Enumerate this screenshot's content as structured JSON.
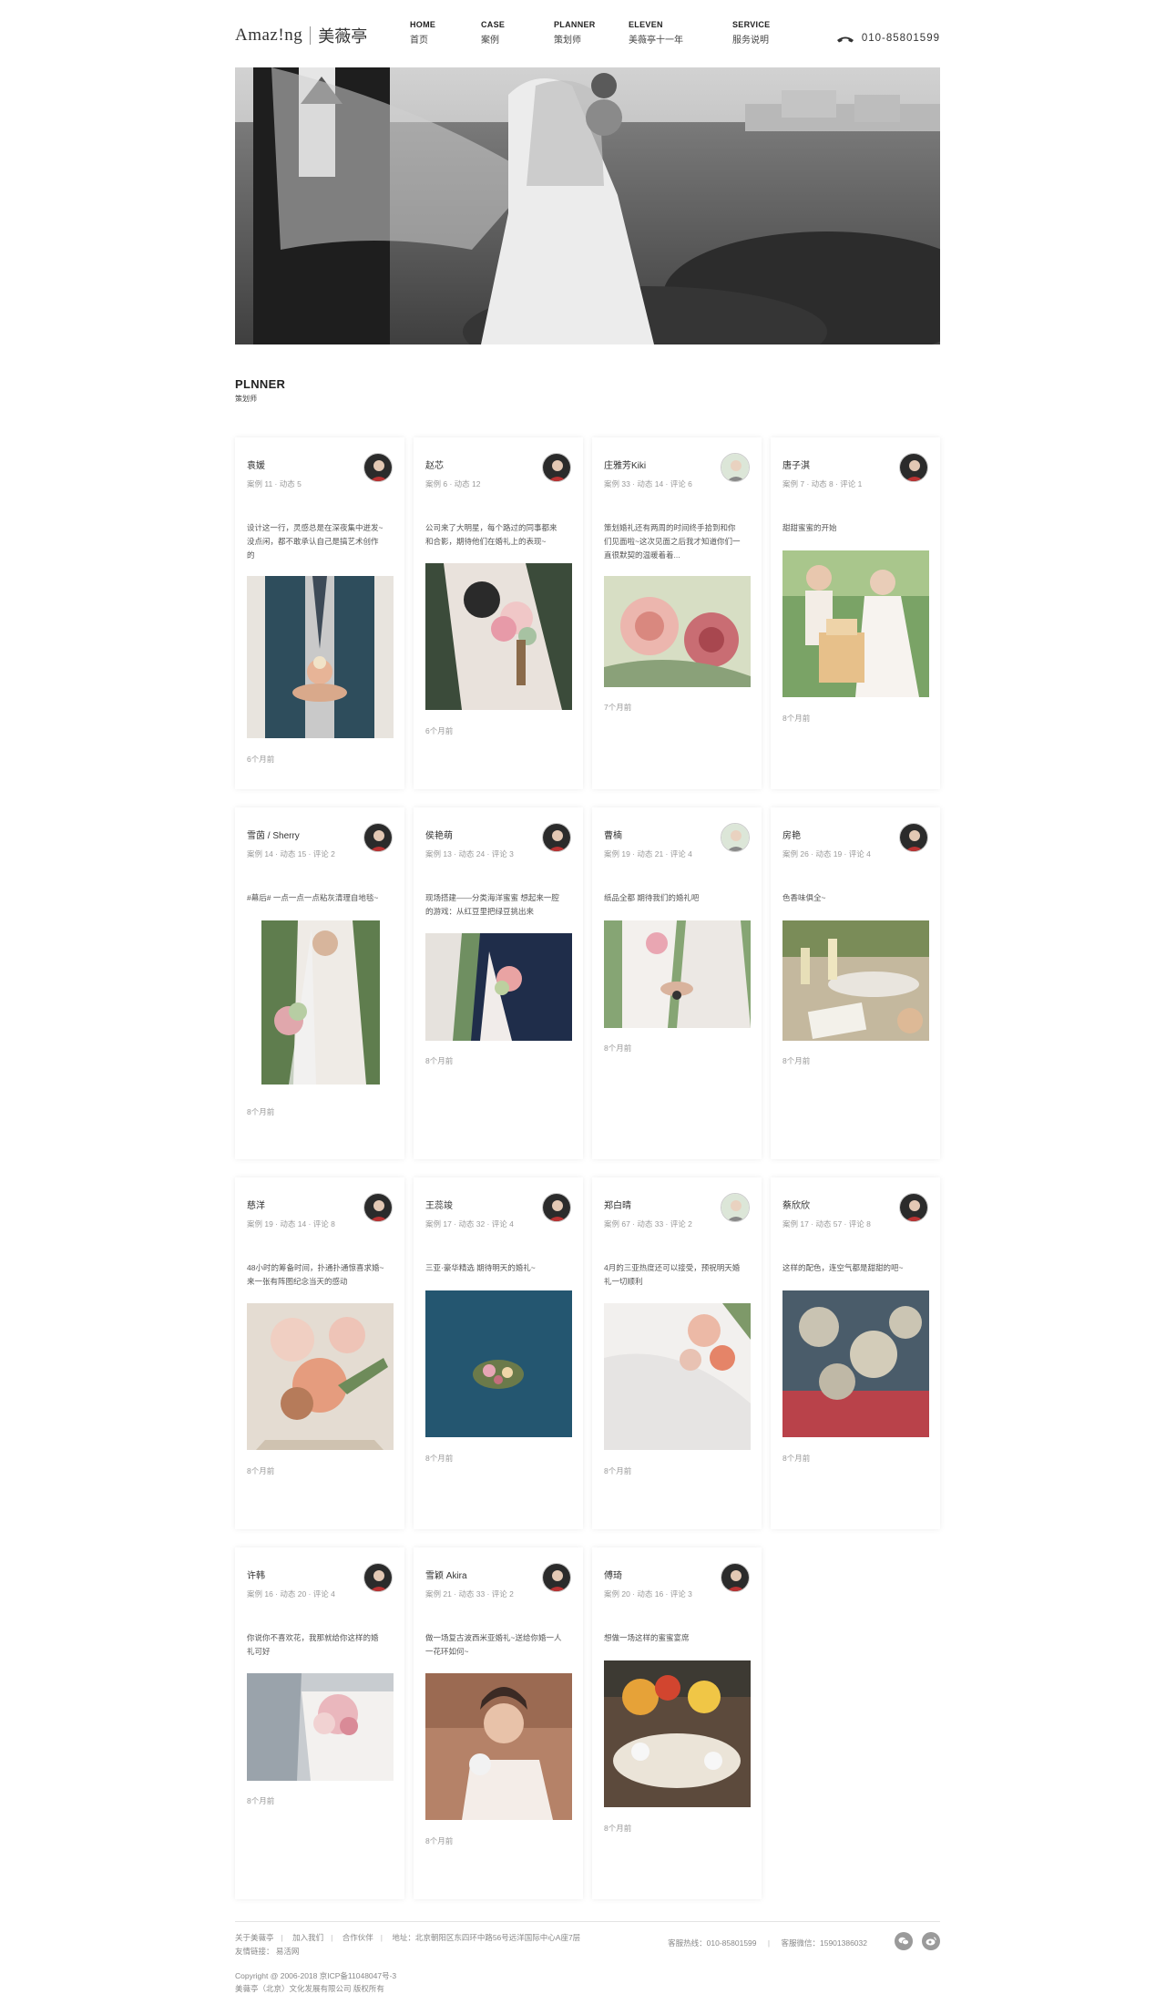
{
  "header": {
    "logo_en": "Amaz!ng",
    "logo_cn": "美薇亭",
    "nav": [
      {
        "en": "HOME",
        "cn": "首页"
      },
      {
        "en": "CASE",
        "cn": "案例"
      },
      {
        "en": "PLANNER",
        "cn": "策划师"
      },
      {
        "en": "ELEVEN",
        "cn": "美薇亭十一年"
      },
      {
        "en": "SERVICE",
        "cn": "服务说明"
      }
    ],
    "phone": "010-85801599"
  },
  "section": {
    "title_en": "PLNNER",
    "title_cn": "策划师"
  },
  "cards": [
    {
      "name": "袁媛",
      "meta": "案例 11 · 动态 5",
      "text": "设计这一行，灵感总是在深夜集中迸发~没点闲，都不敢承认自己是搞艺术创作的",
      "time": "6个月前"
    },
    {
      "name": "赵芯",
      "meta": "案例 6 · 动态 12",
      "text": "公司来了大明星，每个路过的同事都来和合影，期待他们在婚礼上的表现~",
      "time": "6个月前"
    },
    {
      "name": "庄雅芳Kiki",
      "meta": "案例 33 · 动态 14 · 评论 6",
      "text": "策划婚礼还有两周的时间终手拾到和你们见面啦~这次见面之后我才知道你们一直很默契的温暖着着...",
      "time": "7个月前"
    },
    {
      "name": "唐子淇",
      "meta": "案例 7 · 动态 8 · 评论 1",
      "text": "甜甜蜜蜜的开始",
      "time": "8个月前"
    },
    {
      "name": "雪茵 / Sherry",
      "meta": "案例 14 · 动态 15 · 评论 2",
      "text": "#幕后# 一点一点一点粘灰清理自地毯~",
      "time": "8个月前"
    },
    {
      "name": "侯艳萌",
      "meta": "案例 13 · 动态 24 · 评论 3",
      "text": "现场搭建——分类海洋蜜蜜 想起来一腔的游戏：从红豆里把绿豆挑出来",
      "time": "8个月前"
    },
    {
      "name": "曹楠",
      "meta": "案例 19 · 动态 21 · 评论 4",
      "text": "纸品全都 期待我们的婚礼吧",
      "time": "8个月前"
    },
    {
      "name": "房艳",
      "meta": "案例 26 · 动态 19 · 评论 4",
      "text": "色香味俱全~",
      "time": "8个月前"
    },
    {
      "name": "慈洋",
      "meta": "案例 19 · 动态 14 · 评论 8",
      "text": "48小时的筹备时间，扑通扑通惊喜求婚~来一张有阵图纪念当天的感动",
      "time": "8个月前"
    },
    {
      "name": "王蕊竣",
      "meta": "案例 17 · 动态 32 · 评论 4",
      "text": "三亚·豪华精选 期待明天的婚礼~",
      "time": "8个月前"
    },
    {
      "name": "郑白晴",
      "meta": "案例 67 · 动态 33 · 评论 2",
      "text": "4月的三亚热度还可以接受，预祝明天婚礼一切顺利",
      "time": "8个月前"
    },
    {
      "name": "蔡欣欣",
      "meta": "案例 17 · 动态 57 · 评论 8",
      "text": "这样的配色，连空气都是甜甜的吧~",
      "time": "8个月前"
    },
    {
      "name": "许韩",
      "meta": "案例 16 · 动态 20 · 评论 4",
      "text": "你说你不喜欢花，我那就给你这样的婚礼可好",
      "time": "8个月前"
    },
    {
      "name": "雪颖 Akira",
      "meta": "案例 21 · 动态 33 · 评论 2",
      "text": "做一场复古波西米亚婚礼~送给你婚一人一花环如何~",
      "time": "8个月前"
    },
    {
      "name": "傅琦",
      "meta": "案例 20 · 动态 16 · 评论 3",
      "text": "想做一场这样的蜜蜜宴席",
      "time": "8个月前"
    }
  ],
  "footer": {
    "links": [
      "关于美薇亭",
      "加入我们",
      "合作伙伴",
      "地址：北京朝阳区东四环中路56号远洋国际中心A座7层"
    ],
    "friend_label": "友情链接：",
    "friend_link": "易活网",
    "copyright": "Copyright @ 2006-2018 京ICP备11048047号-3",
    "company": "美薇亭（北京）文化发展有限公司 版权所有",
    "hotline": "客服热线：010-85801599",
    "wechat": "客服微信：15901386032",
    "icons": [
      "wechat-icon",
      "weibo-icon"
    ]
  }
}
